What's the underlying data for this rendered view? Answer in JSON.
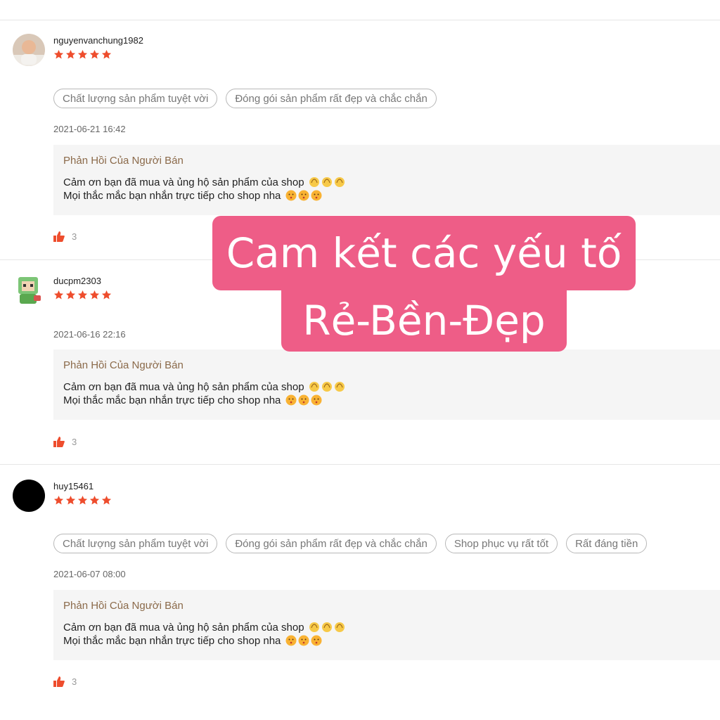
{
  "reviews": [
    {
      "username": "nguyenvanchung1982",
      "rating": 5,
      "tags": [
        "Chất lượng sản phẩm tuyệt vời",
        "Đóng gói sản phẩm rất đẹp và chắc chắn"
      ],
      "timestamp": "2021-06-21 16:42",
      "reply_title": "Phản Hồi Của Người Bán",
      "reply_line1": "Cảm ơn bạn đã mua và ủng hộ sản phẩm của shop",
      "reply_line2": "Mọi thắc mắc bạn nhắn trực tiếp cho shop nha",
      "likes": "3"
    },
    {
      "username": "ducpm2303",
      "rating": 5,
      "tags": [],
      "timestamp": "2021-06-16 22:16",
      "reply_title": "Phản Hồi Của Người Bán",
      "reply_line1": "Cảm ơn bạn đã mua và ủng hộ sản phẩm của shop",
      "reply_line2": "Mọi thắc mắc bạn nhắn trực tiếp cho shop nha",
      "likes": "3"
    },
    {
      "username": "huy15461",
      "rating": 5,
      "tags": [
        "Chất lượng sản phẩm tuyệt vời",
        "Đóng gói sản phẩm rất đẹp và chắc chắn",
        "Shop phục vụ rất tốt",
        "Rất đáng tiền"
      ],
      "timestamp": "2021-06-07 08:00",
      "reply_title": "Phản Hồi Của Người Bán",
      "reply_line1": "Cảm ơn bạn đã mua và ủng hộ sản phẩm của shop",
      "reply_line2": "Mọi thắc mắc bạn nhắn trực tiếp cho shop nha",
      "likes": "3"
    }
  ],
  "banner": {
    "line1": "Cam kết các yếu tố",
    "line2": "Rẻ-Bền-Đẹp"
  },
  "colors": {
    "star": "#ee4d2d",
    "banner": "#ee5d87",
    "reply_title": "#8b6a4a"
  },
  "icons": {
    "star": "star-icon",
    "like": "thumbs-up-icon",
    "clap": "clapping-hands-emoji",
    "kiss": "kissing-face-emoji"
  }
}
